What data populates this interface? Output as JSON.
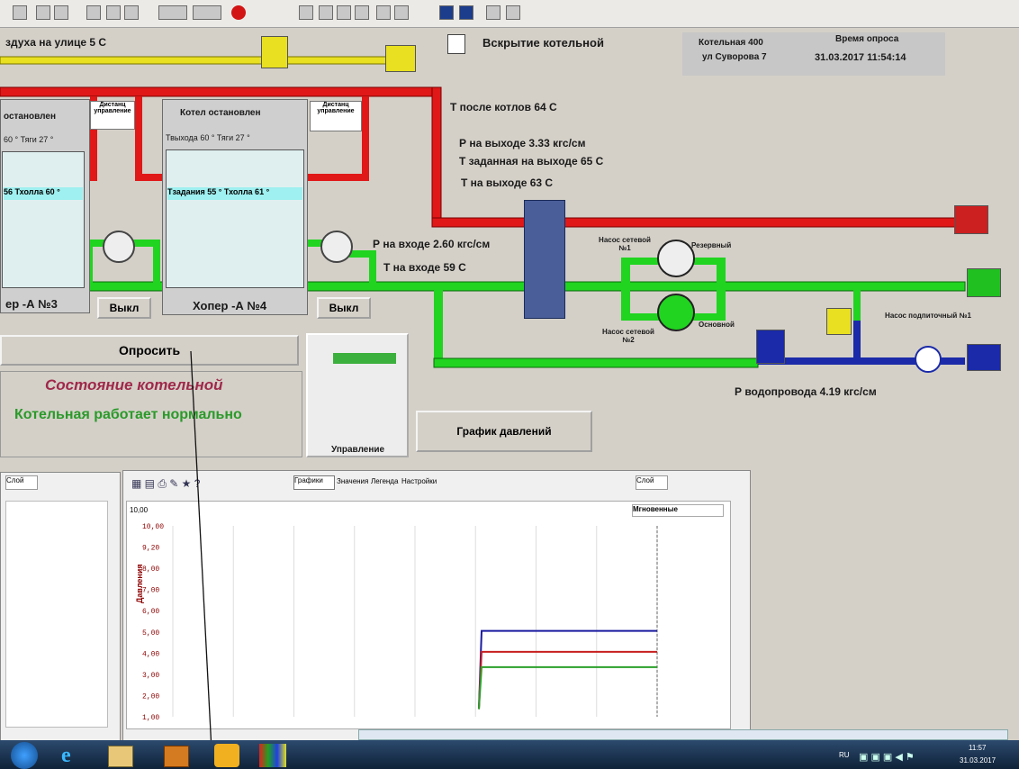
{
  "header": {
    "air_outside": "здуха на улице  5 С",
    "opening_label": "Вскрытие котельной",
    "boiler_house_line1": "Котельная 400",
    "boiler_house_line2": "ул Суворова 7",
    "poll_time_label": "Время опроса",
    "poll_time_value": "31.03.2017 11:54:14"
  },
  "boiler3": {
    "status": "остановлен",
    "remote": "Дистанц управление",
    "params": "60 °  Тяги  27 °",
    "screen_line": "56  Тхолла  60 °",
    "name": "ер -А №3",
    "off_label": "Выкл"
  },
  "boiler4": {
    "status": "Котел остановлен",
    "remote": "Дистанц управление",
    "params": "Твыхода  60 °    Тяги  27 °",
    "screen_line": "Тзадания  55 ° Тхолла  61 °",
    "name": "Хопер -А №4",
    "off_label": "Выкл"
  },
  "process": {
    "t_after_boilers": "Т после котлов  64 С",
    "p_out": "Р на выходе   3.33 кгс/см",
    "t_set_out": "Т заданная на выходе  65   С",
    "t_out": "Т на выходе  63    С",
    "p_in": "Р на входе   2.60 кгс/см",
    "t_in": "Т на входе  59   С",
    "pump1": "Насос сетевой №1",
    "pump1_mode": "Резервный",
    "pump2": "Насос сетевой №2",
    "pump2_mode": "Основной",
    "makeup_pump": "Насос подпиточный №1",
    "p_water": "Р водопровода   4.19 кгс/см"
  },
  "controls": {
    "poll_button": "Опросить",
    "state_title": "Состояние котельной",
    "state_text": "Котельная работает нормально",
    "pressure_chart_button": "График давлений",
    "control_panel_label": "Управление"
  },
  "chart_toolbar": {
    "tabs": [
      "Графики",
      "Значения",
      "Легенда",
      "Настройки"
    ],
    "layer_left": "Слой",
    "layer_right": "Слой",
    "mode": "Мгновенные",
    "ymax_label": "10,00"
  },
  "chart_data": {
    "type": "line",
    "yticks": [
      "10,00",
      "9,20",
      "8,00",
      "7,00",
      "6,00",
      "5,00",
      "4,00",
      "3,00",
      "2,00",
      "1,00"
    ],
    "ylabel": "Давления",
    "series": [
      {
        "color": "#1a1aa0",
        "values": [
          0.4,
          4.5,
          4.5,
          4.5
        ]
      },
      {
        "color": "#c81e1e",
        "values": [
          0.4,
          3.4,
          3.4,
          3.4
        ]
      },
      {
        "color": "#2aa02a",
        "values": [
          0.4,
          2.6,
          2.6,
          2.6
        ]
      }
    ]
  },
  "taskbar": {
    "lang": "RU",
    "time": "11:57",
    "date": "31.03.2017"
  }
}
